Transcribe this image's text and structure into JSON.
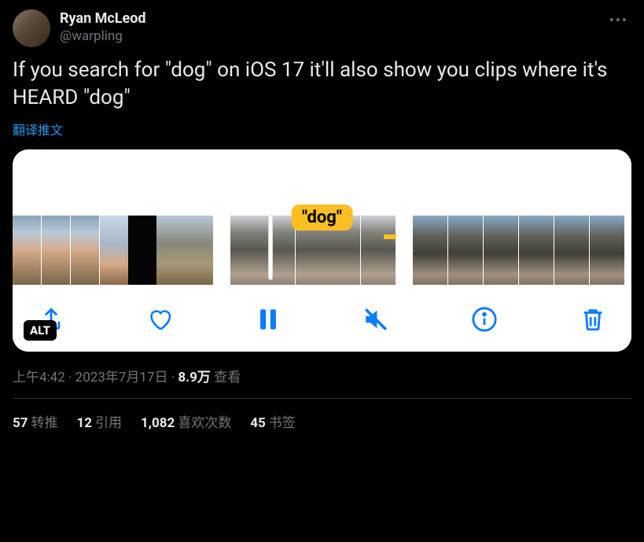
{
  "author": {
    "display_name": "Ryan McLeod",
    "handle": "@warpling"
  },
  "tweet_text": "If you search for \"dog\" on iOS 17 it'll also show you clips where it's HEARD \"dog\"",
  "translate_label": "翻译推文",
  "media": {
    "badge_text": "\"dog\"",
    "alt_label": "ALT"
  },
  "meta": {
    "time": "上午4:42",
    "dot1": " · ",
    "date": "2023年7月17日",
    "dot2": " · ",
    "views_count": "8.9万",
    "views_label": " 查看"
  },
  "stats": {
    "retweets": {
      "count": "57",
      "label": "转推"
    },
    "quotes": {
      "count": "12",
      "label": "引用"
    },
    "likes": {
      "count": "1,082",
      "label": "喜欢次数"
    },
    "bookmarks": {
      "count": "45",
      "label": "书签"
    }
  }
}
